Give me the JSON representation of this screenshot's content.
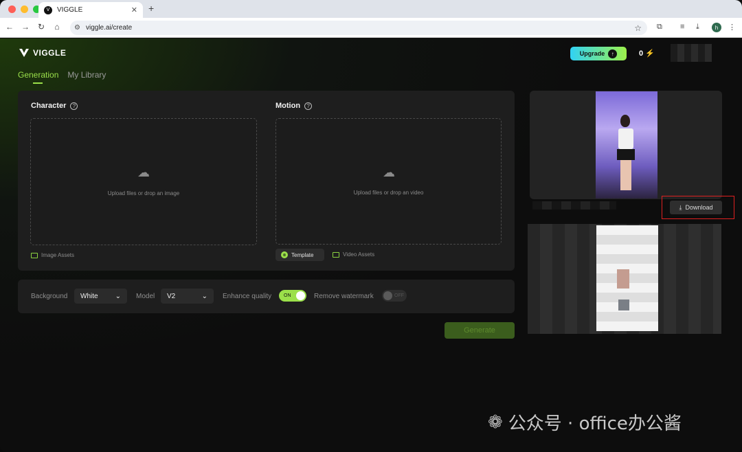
{
  "browser": {
    "tab_title": "VIGGLE",
    "tab_favicon": "V",
    "new_tab": "+",
    "url": "viggle.ai/create",
    "profile_initial": "h"
  },
  "header": {
    "logo_text": "VIGGLE",
    "upgrade_label": "Upgrade",
    "credits": "0"
  },
  "nav": {
    "tabs": [
      {
        "label": "Generation",
        "active": true
      },
      {
        "label": "My Library",
        "active": false
      }
    ]
  },
  "character": {
    "title": "Character",
    "drop_text": "Upload files or drop an image",
    "assets_link": "Image Assets"
  },
  "motion": {
    "title": "Motion",
    "drop_text": "Upload files or drop an video",
    "template_label": "Template",
    "assets_link": "Video Assets"
  },
  "settings": {
    "background_label": "Background",
    "background_value": "White",
    "model_label": "Model",
    "model_value": "V2",
    "enhance_label": "Enhance quality",
    "enhance_state": "ON",
    "watermark_label": "Remove watermark",
    "watermark_state": "OFF"
  },
  "generate_label": "Generate",
  "result": {
    "download_label": "Download"
  },
  "watermark_text": "公众号 · office办公酱",
  "colors": {
    "accent": "#9be04a",
    "highlight_box": "#e02020"
  }
}
